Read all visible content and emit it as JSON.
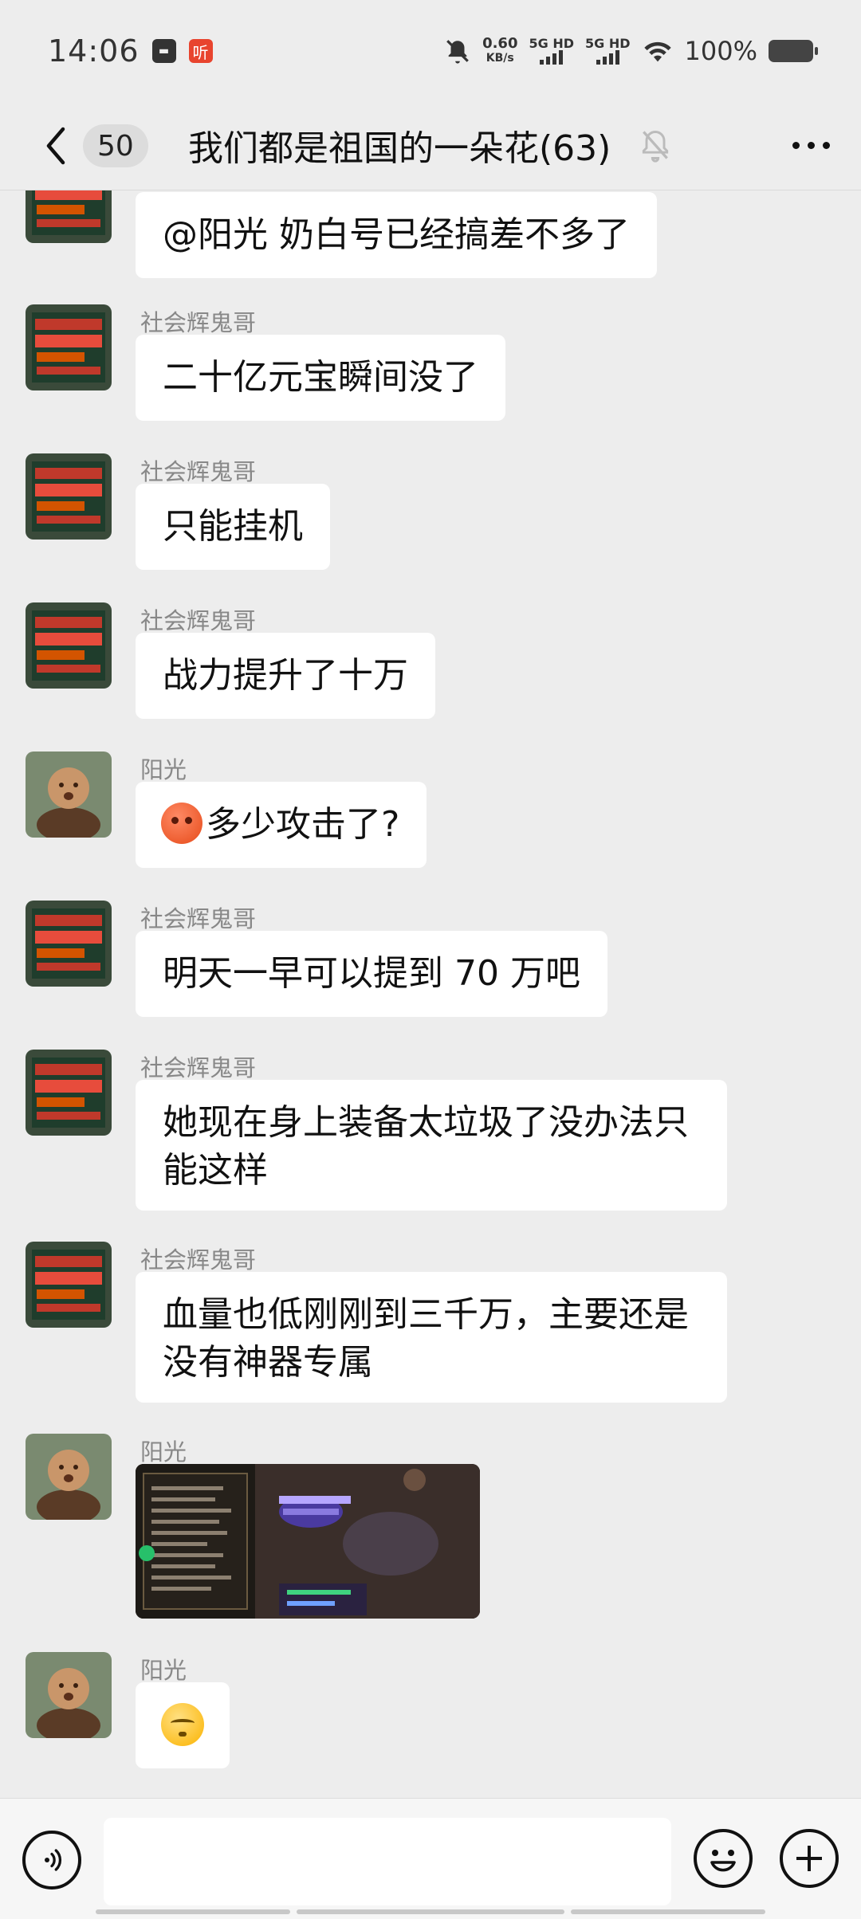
{
  "status_bar": {
    "time": "14:06",
    "notification_app": "听",
    "net_speed_value": "0.60",
    "net_speed_unit": "KB/s",
    "sim1": "5G HD",
    "sim2": "5G HD",
    "battery": "100%",
    "icons": [
      "message-icon",
      "listen-app-icon",
      "mute-notification-icon",
      "signal-icon",
      "wifi-icon",
      "battery-icon"
    ]
  },
  "nav": {
    "unread_count": "50",
    "title": "我们都是祖国的一朵花(63)",
    "icons": [
      "back-chevron-icon",
      "muted-bell-icon",
      "more-dots-icon"
    ]
  },
  "messages": [
    {
      "sender": "",
      "text": "@阳光  奶白号已经搞差不多了",
      "avatar": "billboard"
    },
    {
      "sender": "社会辉鬼哥",
      "text": "二十亿元宝瞬间没了",
      "avatar": "billboard"
    },
    {
      "sender": "社会辉鬼哥",
      "text": "只能挂机",
      "avatar": "billboard"
    },
    {
      "sender": "社会辉鬼哥",
      "text": "战力提升了十万",
      "avatar": "billboard"
    },
    {
      "sender": "阳光",
      "text": "多少攻击了?",
      "avatar": "monk",
      "emoji": "angry-face"
    },
    {
      "sender": "社会辉鬼哥",
      "text": "明天一早可以提到 70 万吧",
      "avatar": "billboard"
    },
    {
      "sender": "社会辉鬼哥",
      "text_line1": "她现在身上装备太垃圾了没办法只",
      "text_line2": "能这样",
      "avatar": "billboard"
    },
    {
      "sender": "社会辉鬼哥",
      "text_line1": "血量也低刚刚到三千万，主要还是",
      "text_line2": "没有神器专属",
      "avatar": "billboard"
    },
    {
      "sender": "阳光",
      "type": "image",
      "avatar": "monk"
    },
    {
      "sender": "阳光",
      "emoji": "sighing-face",
      "avatar": "monk"
    }
  ],
  "input": {
    "placeholder": "",
    "icons": [
      "voice-icon",
      "emoji-icon",
      "plus-icon"
    ]
  },
  "colors": {
    "background": "#ededed",
    "bubble": "#ffffff",
    "sender_text": "#888888"
  }
}
